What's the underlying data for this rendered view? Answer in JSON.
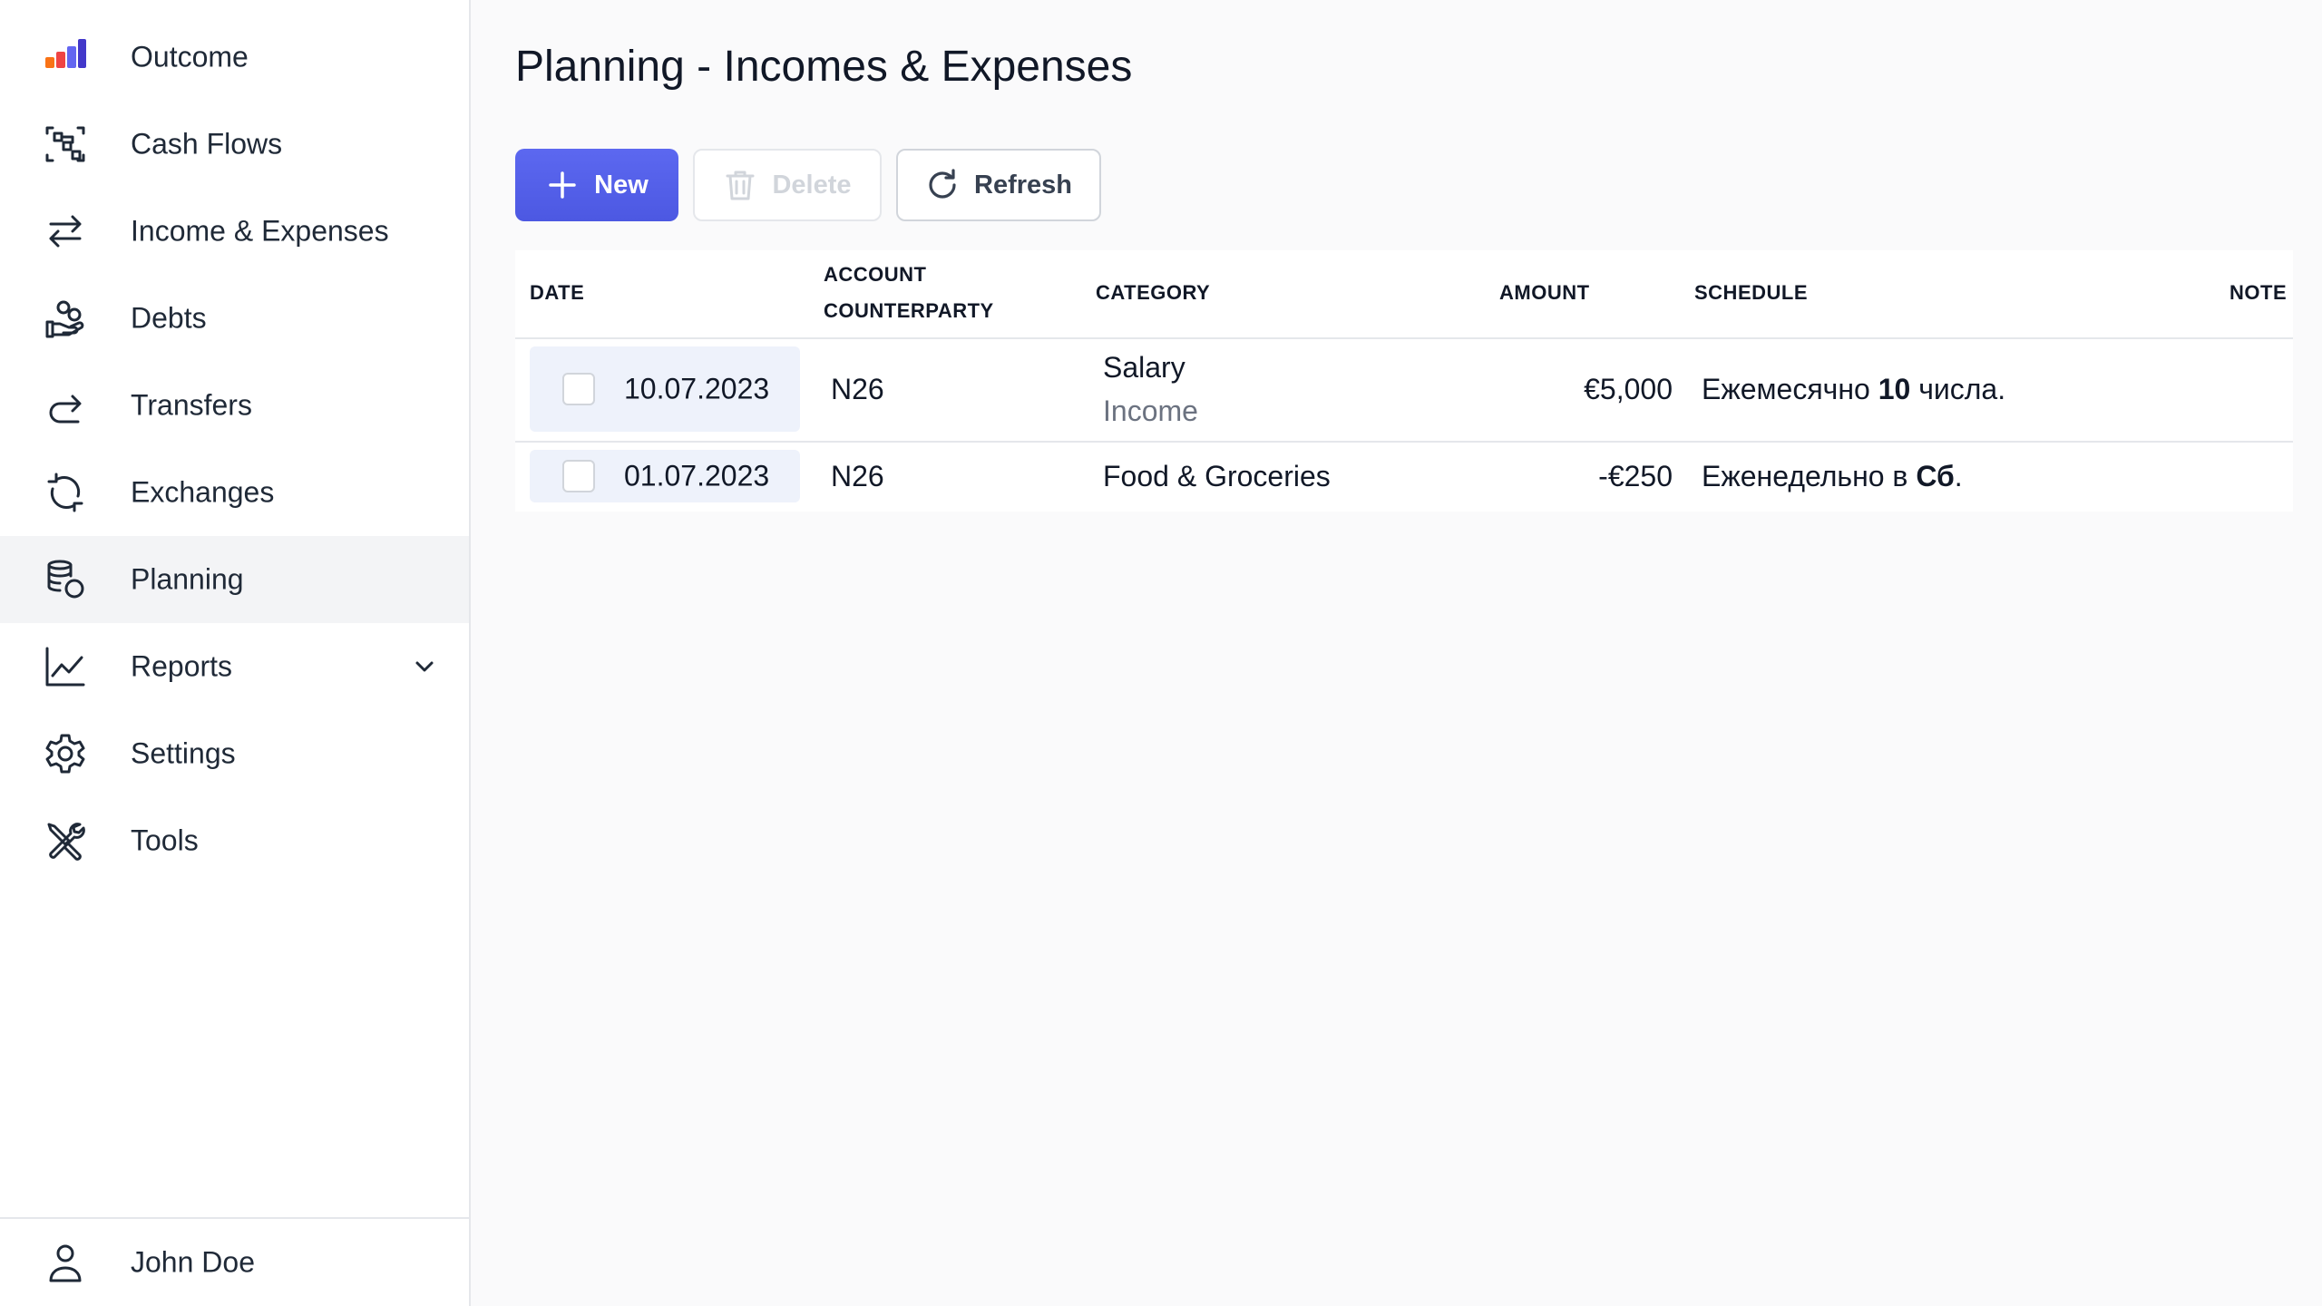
{
  "sidebar": {
    "items": [
      {
        "label": "Outcome",
        "icon": "outcome-logo-icon"
      },
      {
        "label": "Cash Flows",
        "icon": "cash-flows-icon"
      },
      {
        "label": "Income & Expenses",
        "icon": "arrows-right-left-icon"
      },
      {
        "label": "Debts",
        "icon": "hand-coins-icon"
      },
      {
        "label": "Transfers",
        "icon": "redo-arrow-icon"
      },
      {
        "label": "Exchanges",
        "icon": "refresh-arrows-icon"
      },
      {
        "label": "Planning",
        "icon": "coins-stack-icon",
        "active": true
      },
      {
        "label": "Reports",
        "icon": "chart-line-icon",
        "expandable": true
      },
      {
        "label": "Settings",
        "icon": "gear-icon"
      },
      {
        "label": "Tools",
        "icon": "wrench-screwdriver-icon"
      }
    ],
    "user": {
      "name": "John Doe",
      "icon": "user-icon"
    }
  },
  "page": {
    "title": "Planning - Incomes & Expenses"
  },
  "toolbar": {
    "new_label": "New",
    "delete_label": "Delete",
    "refresh_label": "Refresh"
  },
  "table": {
    "headers": {
      "date": "DATE",
      "account": "ACCOUNT",
      "counterparty": "COUNTERPARTY",
      "category": "CATEGORY",
      "amount": "AMOUNT",
      "schedule": "SCHEDULE",
      "note": "NOTE"
    },
    "rows": [
      {
        "date": "10.07.2023",
        "account": "N26",
        "category": "Salary",
        "category_sub": "Income",
        "amount": "€5,000",
        "schedule_prefix": "Ежемесячно ",
        "schedule_bold": "10",
        "schedule_suffix": " числа."
      },
      {
        "date": "01.07.2023",
        "account": "N26",
        "category": "Food & Groceries",
        "amount": "-€250",
        "schedule_prefix": "Еженедельно в ",
        "schedule_bold": "Сб",
        "schedule_suffix": "."
      }
    ]
  },
  "colors": {
    "accent": "#4f5be6",
    "active_nav": "#f3f4f6",
    "selected_date_bg": "#eef2fb"
  }
}
